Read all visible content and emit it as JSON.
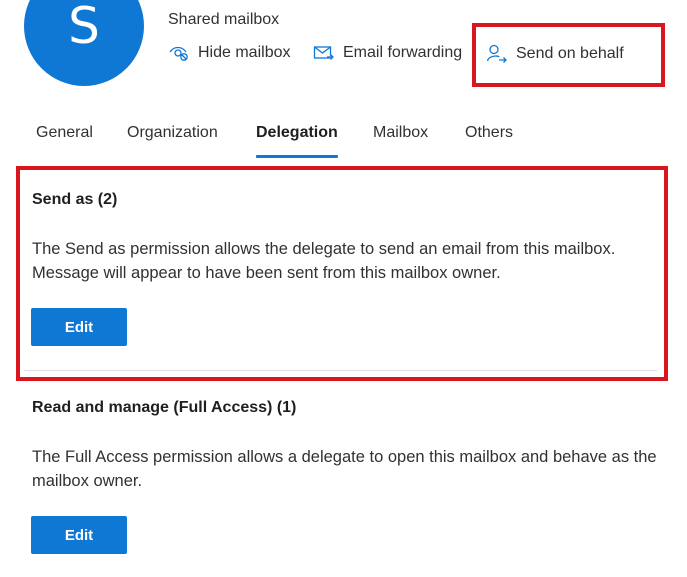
{
  "header": {
    "avatar_letter": "S",
    "subtitle": "Shared mailbox",
    "actions": [
      {
        "label": "Hide mailbox",
        "icon": "eye-hide-icon"
      },
      {
        "label": "Email forwarding",
        "icon": "mail-forward-icon"
      },
      {
        "label": "Send on behalf",
        "icon": "person-send-icon"
      }
    ]
  },
  "tabs": [
    {
      "label": "General",
      "active": false
    },
    {
      "label": "Organization",
      "active": false
    },
    {
      "label": "Delegation",
      "active": true
    },
    {
      "label": "Mailbox",
      "active": false
    },
    {
      "label": "Others",
      "active": false
    }
  ],
  "sections": [
    {
      "title": "Send as (2)",
      "description": "The Send as permission allows the delegate to send an email from this mailbox. Message will appear to have been sent from this mailbox owner.",
      "button_label": "Edit"
    },
    {
      "title": "Read and manage (Full Access) (1)",
      "description": "The Full Access permission allows a delegate to open this mailbox and behave as the mailbox owner.",
      "button_label": "Edit"
    }
  ],
  "colors": {
    "accent": "#0f78d4",
    "highlight": "#d9161d",
    "text": "#201f1e"
  }
}
